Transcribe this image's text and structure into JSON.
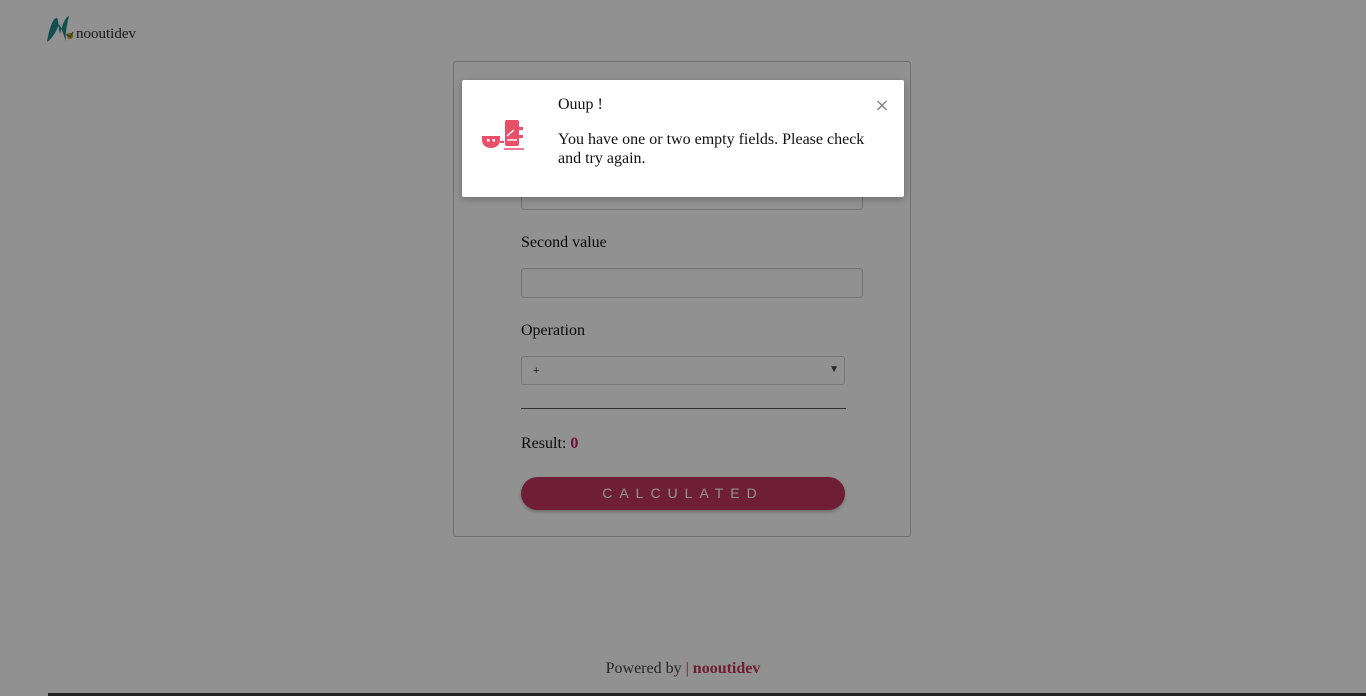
{
  "brand": {
    "name": "nooutidev"
  },
  "form": {
    "second_label": "Second value",
    "operation_label": "Operation",
    "operation_selected": "+",
    "result_label": "Result:",
    "result_value": "0",
    "button_label": "CALCULATED"
  },
  "footer": {
    "powered_by": "Powered by",
    "separator": "|",
    "brand": "nooutidev"
  },
  "modal": {
    "title": "Ouup !",
    "message": "You have one or two empty fields. Please check and try again.",
    "close_symbol": "×",
    "icon": "broken-plug-icon"
  },
  "colors": {
    "accent": "#c1365f",
    "logo_teal": "#1e8c8c",
    "logo_orange": "#e0a030",
    "icon_pink": "#e8506a"
  }
}
